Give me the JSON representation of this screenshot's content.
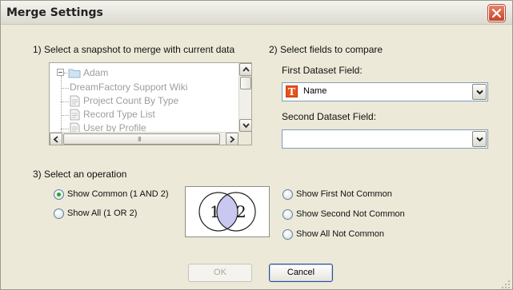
{
  "window": {
    "title": "Merge Settings"
  },
  "snapshot_section": {
    "label": "1) Select a snapshot to merge with current data",
    "tree": [
      {
        "label": "Adam",
        "icon": "folder-icon",
        "expander": "minus"
      },
      {
        "label": "DreamFactory Support Wiki",
        "icon": "none"
      },
      {
        "label": "Project Count By Type",
        "icon": "document-icon"
      },
      {
        "label": "Record Type List",
        "icon": "document-icon"
      },
      {
        "label": "User by Profile",
        "icon": "document-icon"
      }
    ],
    "hscroll_grip": "III"
  },
  "fields_section": {
    "label": "2) Select fields to compare",
    "first_field_label": "First Dataset Field:",
    "first_field_value": "Name",
    "first_field_icon": "T",
    "second_field_label": "Second Dataset Field:",
    "second_field_value": ""
  },
  "operation_section": {
    "label": "3) Select an operation",
    "options": [
      {
        "label": "Show Common (1 AND 2)",
        "selected": true
      },
      {
        "label": "Show All (1 OR 2)",
        "selected": false
      },
      {
        "label": "Show First Not Common",
        "selected": false
      },
      {
        "label": "Show Second Not Common",
        "selected": false
      },
      {
        "label": "Show All Not Common",
        "selected": false
      }
    ],
    "venn": {
      "left_label": "1",
      "right_label": "2",
      "highlight_color": "#c8c8f0"
    }
  },
  "buttons": {
    "ok_label": "OK",
    "cancel_label": "Cancel"
  }
}
